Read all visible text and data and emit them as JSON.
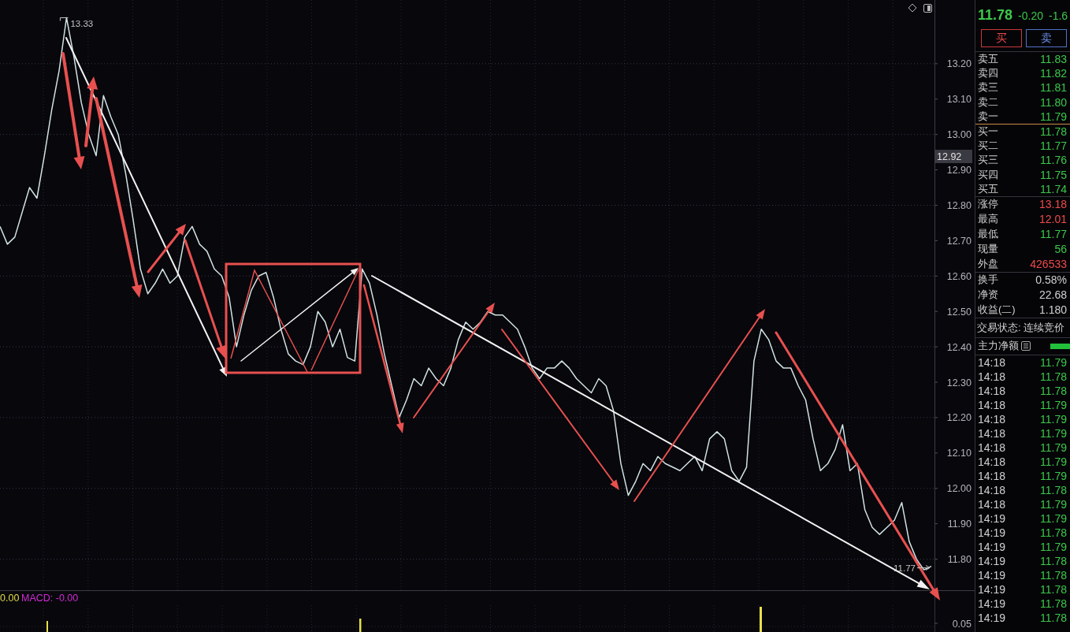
{
  "chart": {
    "chart_data": [
      {
        "type": "line",
        "color": "#d2e2e2",
        "values": [
          12.74,
          12.69,
          12.71,
          12.78,
          12.85,
          12.82,
          12.94,
          13.07,
          13.18,
          13.33,
          13.22,
          13.09,
          13.0,
          12.94,
          13.11,
          13.05,
          13.0,
          12.89,
          12.76,
          12.62,
          12.55,
          12.58,
          12.62,
          12.58,
          12.6,
          12.71,
          12.74,
          12.69,
          12.67,
          12.62,
          12.6,
          12.54,
          12.4,
          12.49,
          12.56,
          12.6,
          12.61,
          12.54,
          12.45,
          12.38,
          12.36,
          12.35,
          12.4,
          12.5,
          12.47,
          12.4,
          12.45,
          12.37,
          12.36,
          12.62,
          12.58,
          12.49,
          12.38,
          12.29,
          12.2,
          12.25,
          12.31,
          12.29,
          12.34,
          12.31,
          12.29,
          12.34,
          12.42,
          12.47,
          12.45,
          12.47,
          12.5,
          12.49,
          12.49,
          12.47,
          12.45,
          12.4,
          12.34,
          12.31,
          12.34,
          12.34,
          12.36,
          12.34,
          12.31,
          12.29,
          12.27,
          12.31,
          12.29,
          12.22,
          12.07,
          11.98,
          12.02,
          12.07,
          12.05,
          12.09,
          12.07,
          12.06,
          12.05,
          12.07,
          12.09,
          12.05,
          12.14,
          12.16,
          12.14,
          12.05,
          12.02,
          12.06,
          12.36,
          12.45,
          12.42,
          12.36,
          12.34,
          12.34,
          12.29,
          12.25,
          12.14,
          12.05,
          12.07,
          12.11,
          12.18,
          12.05,
          12.07,
          11.94,
          11.89,
          11.87,
          11.89,
          11.91,
          11.96,
          11.85,
          11.8,
          11.77,
          11.78
        ],
        "ylim": [
          11.71,
          13.38
        ],
        "yticks": [
          {
            "value": 11.8,
            "label": "11.80"
          },
          {
            "value": 11.9,
            "label": "11.90"
          },
          {
            "value": 12.0,
            "label": "12.00"
          },
          {
            "value": 12.1,
            "label": "12.10"
          },
          {
            "value": 12.2,
            "label": "12.20"
          },
          {
            "value": 12.3,
            "label": "12.30"
          },
          {
            "value": 12.4,
            "label": "12.40"
          },
          {
            "value": 12.5,
            "label": "12.50"
          },
          {
            "value": 12.6,
            "label": "12.60"
          },
          {
            "value": 12.7,
            "label": "12.70"
          },
          {
            "value": 12.8,
            "label": "12.80"
          },
          {
            "value": 12.9,
            "label": "12.90"
          },
          {
            "value": 13.0,
            "label": "13.00"
          },
          {
            "value": 13.1,
            "label": "13.10"
          },
          {
            "value": 13.2,
            "label": "13.20"
          }
        ],
        "grid": true,
        "annotations": [
          "13.33",
          "11.77"
        ]
      }
    ],
    "crosshair_value": "12.92"
  },
  "indicator": {
    "readout": "0.00",
    "macd_readout": "MACD: -0.00",
    "tick_label": "0.05"
  },
  "quote": {
    "price": "11.78",
    "change": "-0.20",
    "change_percent": "-1.6"
  },
  "trade_buttons": [
    {
      "label": "买",
      "kind": "buy"
    },
    {
      "label": "卖",
      "kind": "sell"
    }
  ],
  "order_book": {
    "asks": [
      {
        "label": "卖五",
        "price": "11.83"
      },
      {
        "label": "卖四",
        "price": "11.82"
      },
      {
        "label": "卖三",
        "price": "11.81"
      },
      {
        "label": "卖二",
        "price": "11.80"
      },
      {
        "label": "卖一",
        "price": "11.79"
      }
    ],
    "bids": [
      {
        "label": "买一",
        "price": "11.78"
      },
      {
        "label": "买二",
        "price": "11.77"
      },
      {
        "label": "买三",
        "price": "11.76"
      },
      {
        "label": "买四",
        "price": "11.75"
      },
      {
        "label": "买五",
        "price": "11.74"
      }
    ]
  },
  "stats": [
    {
      "label": "涨停",
      "value": "13.18",
      "color": "#f04a4a"
    },
    {
      "label": "最高",
      "value": "12.01",
      "color": "#f04a4a"
    },
    {
      "label": "最低",
      "value": "11.77",
      "color": "#3cc84a"
    },
    {
      "label": "现量",
      "value": "56",
      "color": "#3cc84a"
    },
    {
      "label": "外盘",
      "value": "426533",
      "color": "#f04a4a"
    }
  ],
  "ratios": [
    {
      "label": "换手",
      "value": "0.58%"
    },
    {
      "label": "净资",
      "value": "22.68"
    },
    {
      "label": "收益(二)",
      "value": "1.180"
    }
  ],
  "trade_status": "交易状态: 连续竞价",
  "main_flow": {
    "label": "主力净额"
  },
  "ticks": [
    {
      "time": "14:18",
      "price": "11.79"
    },
    {
      "time": "14:18",
      "price": "11.78"
    },
    {
      "time": "14:18",
      "price": "11.78"
    },
    {
      "time": "14:18",
      "price": "11.79"
    },
    {
      "time": "14:18",
      "price": "11.79"
    },
    {
      "time": "14:18",
      "price": "11.79"
    },
    {
      "time": "14:18",
      "price": "11.79"
    },
    {
      "time": "14:18",
      "price": "11.79"
    },
    {
      "time": "14:18",
      "price": "11.79"
    },
    {
      "time": "14:18",
      "price": "11.78"
    },
    {
      "time": "14:18",
      "price": "11.79"
    },
    {
      "time": "14:19",
      "price": "11.79"
    },
    {
      "time": "14:19",
      "price": "11.78"
    },
    {
      "time": "14:19",
      "price": "11.79"
    },
    {
      "time": "14:19",
      "price": "11.78"
    },
    {
      "time": "14:19",
      "price": "11.78"
    },
    {
      "time": "14:19",
      "price": "11.78"
    },
    {
      "time": "14:19",
      "price": "11.78"
    },
    {
      "time": "14:19",
      "price": "11.78"
    }
  ]
}
